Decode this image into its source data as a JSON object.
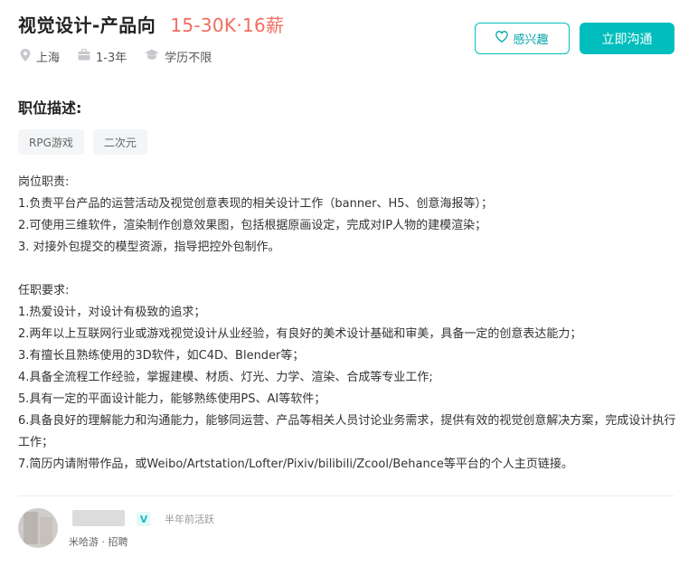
{
  "job": {
    "title": "视觉设计-产品向",
    "salary": "15-30K·16薪",
    "location": "上海",
    "experience": "1-3年",
    "education": "学历不限"
  },
  "actions": {
    "interest_label": "感兴趣",
    "chat_label": "立即沟通"
  },
  "description": {
    "section_title": "职位描述:",
    "tags": [
      "RPG游戏",
      "二次元"
    ],
    "duties_header": "岗位职责:",
    "duties": [
      "1.负责平台产品的运营活动及视觉创意表现的相关设计工作（banner、H5、创意海报等）；",
      "2.可使用三维软件，渲染制作创意效果图，包括根据原画设定，完成对IP人物的建模渲染；",
      "3. 对接外包提交的模型资源，指导把控外包制作。"
    ],
    "requirements_header": "任职要求:",
    "requirements": [
      "1.热爱设计，对设计有极致的追求；",
      "2.两年以上互联网行业或游戏视觉设计从业经验，有良好的美术设计基础和审美，具备一定的创意表达能力；",
      "3.有擅长且熟练使用的3D软件，如C4D、Blender等；",
      "4.具备全流程工作经验，掌握建模、材质、灯光、力学、渲染、合成等专业工作;",
      "5.具有一定的平面设计能力，能够熟练使用PS、AI等软件；",
      "6.具备良好的理解能力和沟通能力，能够同运营、产品等相关人员讨论业务需求，提供有效的视觉创意解决方案，完成设计执行工作；",
      "7.简历内请附带作品，或Weibo/Artstation/Lofter/Pixiv/bilibili/Zcool/Behance等平台的个人主页链接。"
    ]
  },
  "recruiter": {
    "verify_badge": "V",
    "active_status": "半年前活跃",
    "company_role": "米哈游 · 招聘"
  },
  "colors": {
    "accent": "#00bebd",
    "salary": "#f26d5f"
  },
  "icons": [
    "location-icon",
    "briefcase-icon",
    "graduation-cap-icon",
    "heart-icon",
    "verified-icon"
  ]
}
